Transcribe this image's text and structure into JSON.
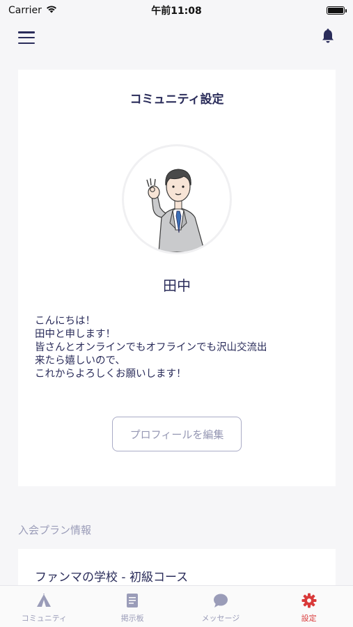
{
  "status_bar": {
    "carrier": "Carrier",
    "time": "午前11:08"
  },
  "nav": {
    "menu_icon": "hamburger-menu-icon",
    "bell_icon": "bell-icon"
  },
  "profile_card": {
    "title": "コミュニティ設定",
    "avatar_icon": "businessman-avatar",
    "name": "田中",
    "bio_lines": [
      "こんにちは！",
      "田中と申します！",
      "皆さんとオンラインでもオフラインでも沢山交流出",
      "来たら嬉しいので、",
      "これからよろしくお願いします！"
    ],
    "edit_button": "プロフィールを編集"
  },
  "plan_section": {
    "label": "入会プラン情報",
    "plan_name": "ファンマの学校 - 初級コース"
  },
  "tab_bar": {
    "tabs": [
      {
        "label": "コミュニティ",
        "icon": "tent-icon",
        "active": false
      },
      {
        "label": "掲示板",
        "icon": "document-icon",
        "active": false
      },
      {
        "label": "メッセージ",
        "icon": "chat-bubble-icon",
        "active": false
      },
      {
        "label": "設定",
        "icon": "gear-icon",
        "active": true
      }
    ]
  },
  "colors": {
    "primary": "#2a2c5a",
    "accent": "#d93a3a",
    "muted": "#9a9cb8",
    "background": "#f6f6f8"
  }
}
